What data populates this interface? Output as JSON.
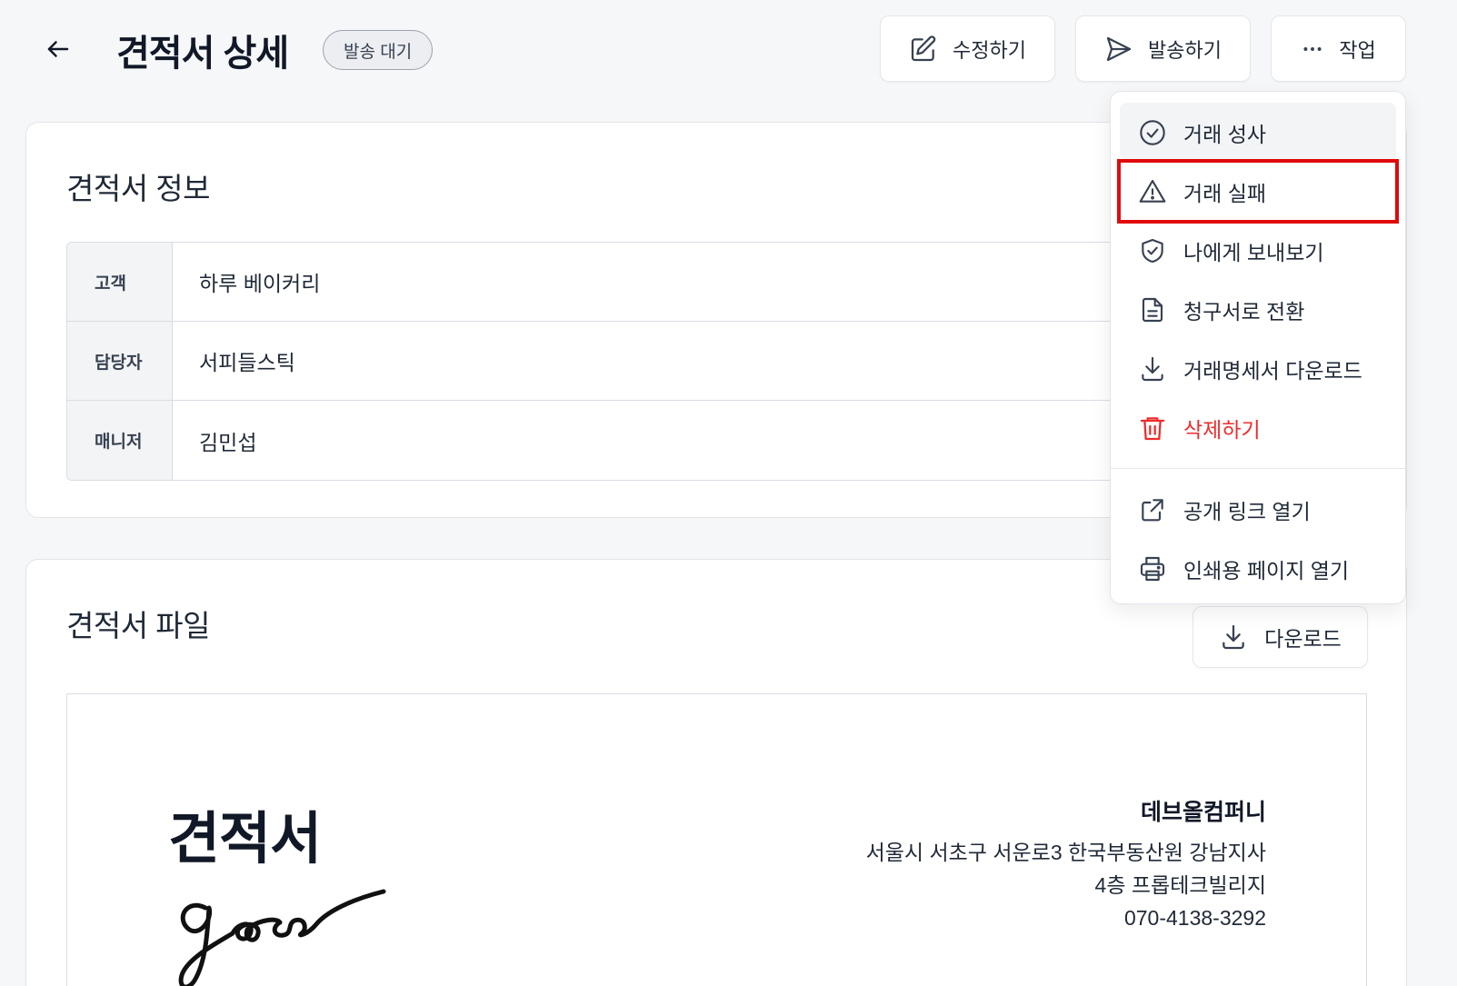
{
  "header": {
    "title": "견적서 상세",
    "status_badge": "발송 대기",
    "edit_label": "수정하기",
    "send_label": "발송하기",
    "actions_label": "작업"
  },
  "info_card": {
    "title": "견적서 정보",
    "rows": [
      {
        "label": "고객",
        "value": "하루 베이커리"
      },
      {
        "label": "담당자",
        "value": "서피들스틱"
      },
      {
        "label": "매니저",
        "value": "김민섭"
      }
    ]
  },
  "file_card": {
    "title": "견적서 파일",
    "download_label": "다운로드",
    "document": {
      "title": "견적서",
      "logo_text": "goose",
      "company_name": "데브올컴퍼니",
      "address_line1": "서울시 서초구 서운로3 한국부동산원 강남지사",
      "address_line2": "4층 프롭테크빌리지",
      "phone": "070-4138-3292"
    }
  },
  "actions_menu": {
    "items": [
      {
        "label": "거래 성사",
        "icon": "check-circle-icon",
        "state": "hover"
      },
      {
        "label": "거래 실패",
        "icon": "warning-triangle-icon",
        "state": "highlighted"
      },
      {
        "label": "나에게 보내보기",
        "icon": "shield-check-icon"
      },
      {
        "label": "청구서로 전환",
        "icon": "document-icon"
      },
      {
        "label": "거래명세서 다운로드",
        "icon": "download-icon"
      },
      {
        "label": "삭제하기",
        "icon": "trash-icon",
        "state": "danger"
      },
      {
        "label": "공개 링크 열기",
        "icon": "external-link-icon"
      },
      {
        "label": "인쇄용 페이지 열기",
        "icon": "printer-icon"
      }
    ]
  },
  "colors": {
    "background": "#f6f7f9",
    "danger": "#ef2b2b",
    "highlight_outline": "#e10a0a"
  }
}
